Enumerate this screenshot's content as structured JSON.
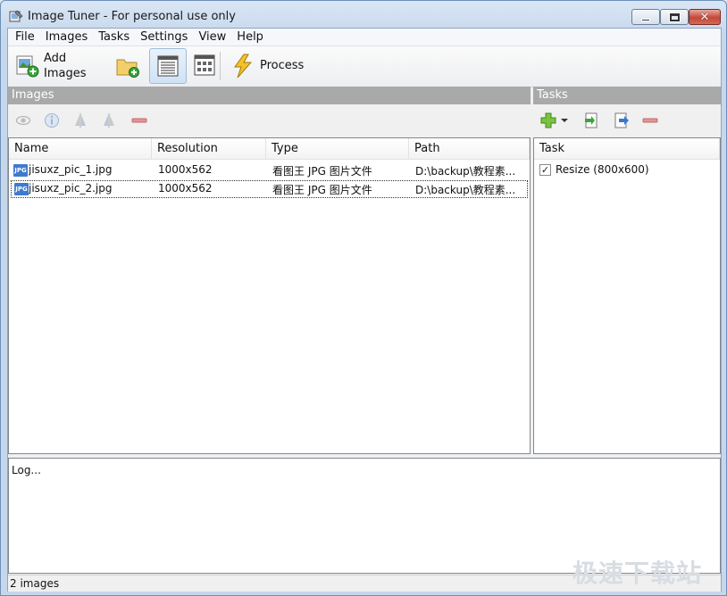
{
  "window": {
    "title": "Image Tuner - For personal use only"
  },
  "menu": [
    "File",
    "Images",
    "Tasks",
    "Settings",
    "View",
    "Help"
  ],
  "toolbar": {
    "add_label": "Add\nImages",
    "add_line1": "Add",
    "add_line2": "Images",
    "process_label": "Process"
  },
  "panels": {
    "images_title": "Images",
    "tasks_title": "Tasks"
  },
  "images_table": {
    "columns": [
      "Name",
      "Resolution",
      "Type",
      "Path"
    ],
    "rows": [
      {
        "name": "jisuxz_pic_1.jpg",
        "resolution": "1000x562",
        "type": "看图王 JPG 图片文件",
        "path": "D:\\backup\\教程素..."
      },
      {
        "name": "jisuxz_pic_2.jpg",
        "resolution": "1000x562",
        "type": "看图王 JPG 图片文件",
        "path": "D:\\backup\\教程素..."
      }
    ]
  },
  "tasks_table": {
    "column": "Task",
    "items": [
      {
        "label": "Resize (800x600)",
        "checked": true
      }
    ]
  },
  "log": {
    "text": "Log..."
  },
  "status": {
    "text": "2 images"
  },
  "watermark": "极速下载站",
  "icons": {
    "jpg_badge": "JPG"
  }
}
